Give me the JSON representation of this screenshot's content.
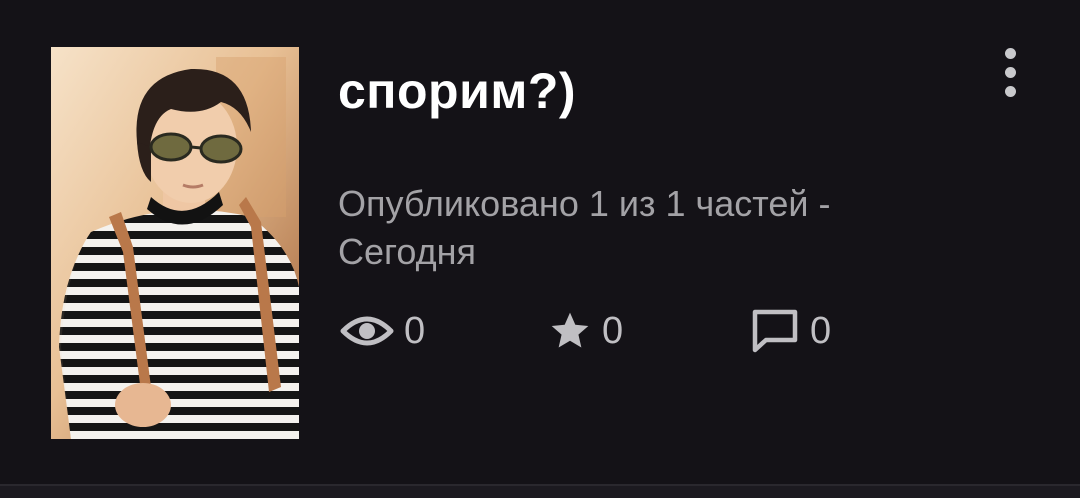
{
  "work": {
    "title": "спорим?)",
    "published_info": "Опубликовано 1 из 1 частей - Сегодня",
    "cover": {
      "icon": "person-photo",
      "dominant_colors": [
        "#e9c7a1",
        "#1a1a1a",
        "#f2f2f2",
        "#b56b3d"
      ]
    },
    "stats": {
      "views": "0",
      "rating": "0",
      "comments": "0"
    }
  },
  "menu": {
    "icon": "more-vertical-icon"
  },
  "theme": {
    "background": "#141217",
    "title_color": "#ffffff",
    "meta_color": "#a3a2a6",
    "icon_color": "#c0bfc3"
  }
}
